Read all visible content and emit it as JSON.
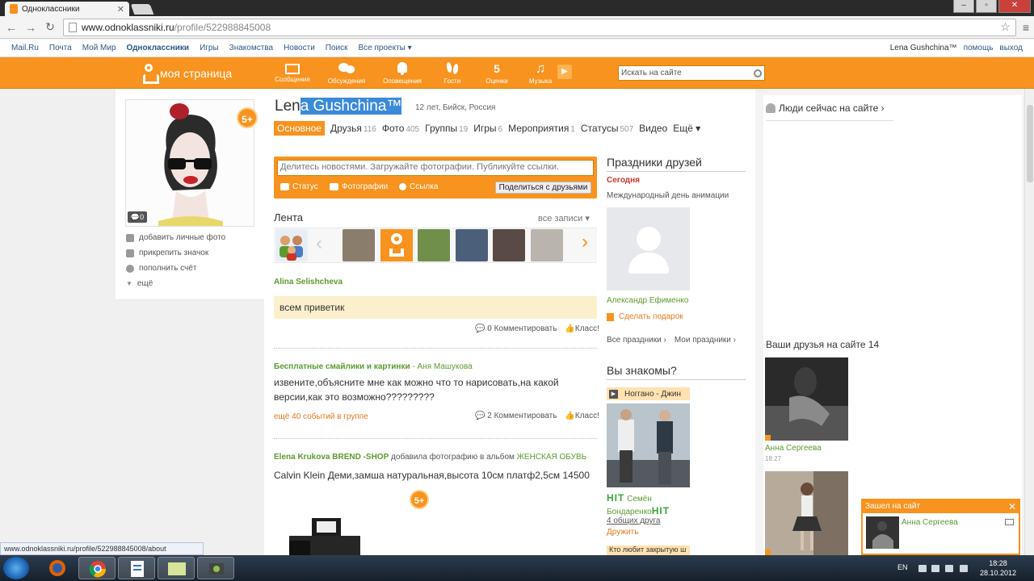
{
  "browser": {
    "tab_title": "Одноклассники",
    "url_host": "www.odnoklassniki.ru",
    "url_path": "/profile/522988845008",
    "status_url": "www.odnoklassniki.ru/profile/522988845008/about"
  },
  "portal": {
    "links": [
      "Mail.Ru",
      "Почта",
      "Мой Мир",
      "Одноклассники",
      "Игры",
      "Знакомства",
      "Новости",
      "Поиск",
      "Все проекты ▾"
    ],
    "user": "Lena Gushchina™",
    "help": "помощь",
    "logout": "выход"
  },
  "toolbar": {
    "logo": "моя страница",
    "items": [
      "Сообщения",
      "Обсуждения",
      "Оповещения",
      "Гости",
      "Оценки",
      "Музыка"
    ],
    "search_placeholder": "Искать на сайте"
  },
  "profile": {
    "name_plain": "Len",
    "name_selected": "a Gushchina™",
    "info": "12 лет, Бийск, Россия",
    "badge": "5+",
    "comments": "0",
    "tabs": [
      {
        "label": "Основное",
        "count": ""
      },
      {
        "label": "Друзья",
        "count": "116"
      },
      {
        "label": "Фото",
        "count": "405"
      },
      {
        "label": "Группы",
        "count": "19"
      },
      {
        "label": "Игры",
        "count": "6"
      },
      {
        "label": "Мероприятия",
        "count": "1"
      },
      {
        "label": "Статусы",
        "count": "507"
      },
      {
        "label": "Видео",
        "count": ""
      },
      {
        "label": "Ещё ▾",
        "count": ""
      }
    ],
    "left_menu": [
      "добавить личные фото",
      "прикрепить значок",
      "пополнить счёт",
      "ещё"
    ]
  },
  "share": {
    "placeholder": "Делитесь новостями. Загружайте фотографии. Публикуйте ссылки.",
    "status": "Статус",
    "photos": "Фотографии",
    "link": "Ссылка",
    "button": "Поделиться с друзьями"
  },
  "feed": {
    "title": "Лента",
    "all": "все записи ▾",
    "post1": {
      "author": "Alina Selishcheva",
      "text": "всем приветик",
      "comment": "0 Комментировать",
      "class": "Класс!"
    },
    "post2": {
      "group": "Бесплатные смайлики и картинки",
      "dash": " - ",
      "author": "Аня Машукова",
      "text": "извените,объясните мне как можно что то нарисовать,на какой версии,как это возможно?????????",
      "more": "ещё 40 событий в группе",
      "comment": "2 Комментировать",
      "class": "Класс!"
    },
    "post3": {
      "author": "Elena Krukova BREND -SHOP",
      "action": " добавила фотографию в альбом ",
      "album": "ЖЕНСКАЯ ОБУВЬ",
      "text": "Calvin Klein Деми,замша натуральная,высота 10см платф2,5см 14500",
      "badge": "5+"
    }
  },
  "holidays": {
    "title": "Праздники друзей",
    "today": "Сегодня",
    "event": "Международный день анимации",
    "friend": "Александр Ефименко",
    "gift": "Сделать подарок",
    "all": "Все праздники ›",
    "mine": "Мои праздники ›"
  },
  "know": {
    "title": "Вы знакомы?",
    "music": "Ноггано - Джин",
    "hit": "HIT",
    "name1": "Семён",
    "name2": "Бондаренко",
    "mutual": "4 общих друга",
    "befriend": "Дружить",
    "more": "Кто любит закрытую ш"
  },
  "right": {
    "online": "Люди сейчас на сайте ›",
    "friends_online": "Ваши друзья на сайте 14",
    "friend1": "Анна Сергеева",
    "time1": "18:27"
  },
  "popup": {
    "title": "Зашел на сайт",
    "close": "✕",
    "name": "Анна Сергеева"
  },
  "taskbar": {
    "lang": "EN",
    "time": "18:28",
    "date": "28.10.2012"
  },
  "colors": {
    "accent": "#f7931e",
    "link": "#2a5885",
    "green": "#5a9b2f"
  }
}
